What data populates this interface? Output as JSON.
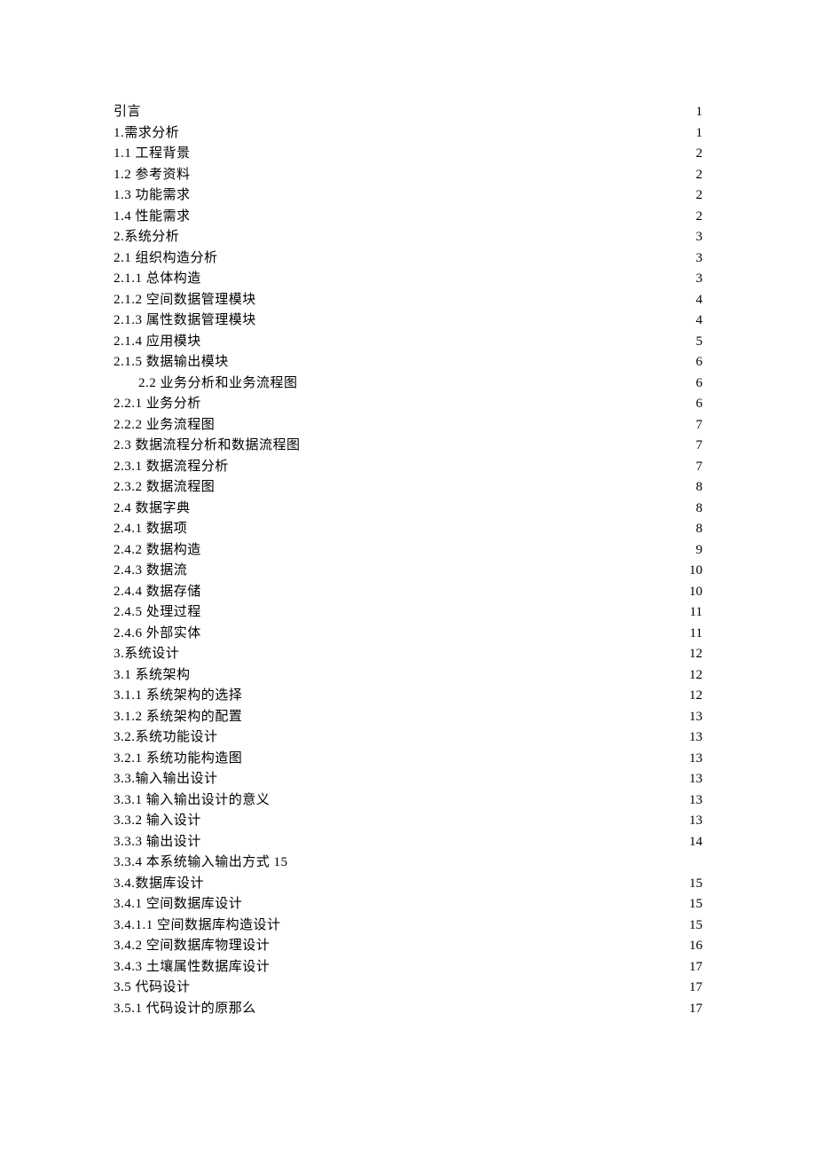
{
  "toc": [
    {
      "title": "引言",
      "page": "1",
      "indent": 0,
      "dots": true
    },
    {
      "title": "1.需求分析",
      "page": "1",
      "indent": 0,
      "dots": true
    },
    {
      "title": "1.1 工程背景",
      "page": "2",
      "indent": 0,
      "dots": true
    },
    {
      "title": "1.2 参考资料",
      "page": "2",
      "indent": 0,
      "dots": true
    },
    {
      "title": "1.3 功能需求",
      "page": "2",
      "indent": 0,
      "dots": true
    },
    {
      "title": "1.4 性能需求",
      "page": "2",
      "indent": 0,
      "dots": true
    },
    {
      "title": "2.系统分析",
      "page": "3",
      "indent": 0,
      "dots": true
    },
    {
      "title": "2.1 组织构造分析",
      "page": "3",
      "indent": 0,
      "dots": true
    },
    {
      "title": "2.1.1 总体构造",
      "page": "3",
      "indent": 0,
      "dots": true
    },
    {
      "title": "2.1.2 空间数据管理模块",
      "page": "4",
      "indent": 0,
      "dots": true
    },
    {
      "title": "2.1.3 属性数据管理模块",
      "page": "4",
      "indent": 0,
      "dots": true
    },
    {
      "title": "2.1.4 应用模块",
      "page": "5",
      "indent": 0,
      "dots": true
    },
    {
      "title": "2.1.5 数据输出模块",
      "page": "6",
      "indent": 0,
      "dots": true
    },
    {
      "title": "2.2 业务分析和业务流程图",
      "page": "6",
      "indent": 28,
      "dots": true
    },
    {
      "title": "2.2.1 业务分析",
      "page": "6",
      "indent": 0,
      "dots": true
    },
    {
      "title": "2.2.2 业务流程图",
      "page": "7",
      "indent": 0,
      "dots": true
    },
    {
      "title": "2.3 数据流程分析和数据流程图",
      "page": "7",
      "indent": 0,
      "dots": true
    },
    {
      "title": "2.3.1 数据流程分析",
      "page": "7",
      "indent": 0,
      "dots": true
    },
    {
      "title": "2.3.2 数据流程图",
      "page": "8",
      "indent": 0,
      "dots": true
    },
    {
      "title": "2.4 数据字典",
      "page": "8",
      "indent": 0,
      "dots": true
    },
    {
      "title": "2.4.1 数据项",
      "page": "8",
      "indent": 0,
      "dots": true
    },
    {
      "title": "2.4.2 数据构造",
      "page": "9",
      "indent": 0,
      "dots": true
    },
    {
      "title": "2.4.3 数据流",
      "page": "10",
      "indent": 0,
      "dots": true
    },
    {
      "title": "2.4.4 数据存储",
      "page": "10",
      "indent": 0,
      "dots": true
    },
    {
      "title": "2.4.5 处理过程",
      "page": "11",
      "indent": 0,
      "dots": true
    },
    {
      "title": "2.4.6 外部实体",
      "page": "11",
      "indent": 0,
      "dots": true
    },
    {
      "title": "3.系统设计",
      "page": "12",
      "indent": 0,
      "dots": true
    },
    {
      "title": "3.1 系统架构",
      "page": "12",
      "indent": 0,
      "dots": true
    },
    {
      "title": "3.1.1  系统架构的选择",
      "page": "12",
      "indent": 0,
      "dots": true
    },
    {
      "title": "3.1.2  系统架构的配置",
      "page": "13",
      "indent": 0,
      "dots": true
    },
    {
      "title": "3.2.系统功能设计",
      "page": "13",
      "indent": 0,
      "dots": true
    },
    {
      "title": "3.2.1 系统功能构造图",
      "page": "13",
      "indent": 0,
      "dots": true
    },
    {
      "title": "3.3.输入输出设计",
      "page": "13",
      "indent": 0,
      "dots": true
    },
    {
      "title": "3.3.1 输入输出设计的意义",
      "page": "13",
      "indent": 0,
      "dots": true
    },
    {
      "title": "3.3.2 输入设计",
      "page": "13",
      "indent": 0,
      "dots": true
    },
    {
      "title": "3.3.3 输出设计",
      "page": "14",
      "indent": 0,
      "dots": true
    },
    {
      "title": "3.3.4 本系统输入输出方式 15",
      "page": "",
      "indent": 0,
      "dots": false
    },
    {
      "title": "3.4.数据库设计",
      "page": "15",
      "indent": 0,
      "dots": true
    },
    {
      "title": "3.4.1 空间数据库设计",
      "page": "15",
      "indent": 0,
      "dots": true
    },
    {
      "title": "3.4.1.1 空间数据库构造设计",
      "page": "15",
      "indent": 0,
      "dots": true
    },
    {
      "title": "3.4.2 空间数据库物理设计",
      "page": "16",
      "indent": 0,
      "dots": true
    },
    {
      "title": "3.4.3 土壤属性数据库设计",
      "page": "17",
      "indent": 0,
      "dots": true
    },
    {
      "title": "3.5 代码设计",
      "page": "17",
      "indent": 0,
      "dots": true
    },
    {
      "title": "3.5.1 代码设计的原那么",
      "page": "17",
      "indent": 0,
      "dots": true
    }
  ]
}
